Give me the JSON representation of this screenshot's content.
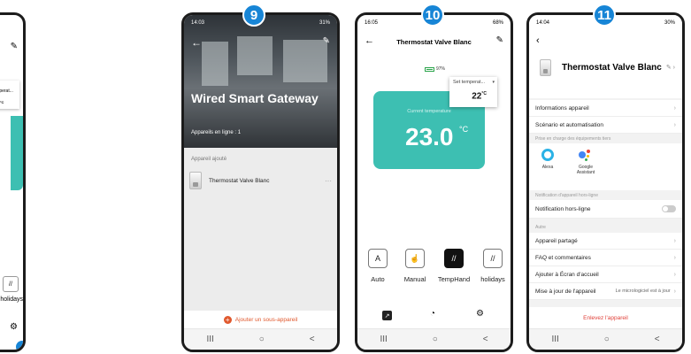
{
  "partial_phone": {
    "set_label": "Set temperat...",
    "set_value": "22",
    "set_unit": "°C",
    "holidays": "holidays",
    "edit_icon": "pencil-icon",
    "gear_icon": "gear-icon"
  },
  "phone9": {
    "badge": "9",
    "status": {
      "time": "14:03",
      "right": "31%"
    },
    "title": "Wired Smart Gateway",
    "online": "Appareils en ligne : 1",
    "section": "Appareil ajouté",
    "device": "Thermostat Valve Blanc",
    "more": "···",
    "add": "Ajouter un sous-appareil"
  },
  "phone10": {
    "badge": "10",
    "status": {
      "time": "16:05",
      "right": "68%"
    },
    "title": "Thermostat Valve Blanc",
    "battery": "97%",
    "current_label": "Current temperature",
    "current_value": "23.0",
    "current_unit": "°C",
    "set_label": "Set temperat...",
    "set_value": "22",
    "set_unit": "°C",
    "modes": [
      {
        "label": "Auto",
        "glyph": "A"
      },
      {
        "label": "Manual",
        "glyph": "☝"
      },
      {
        "label": "TempHand",
        "glyph": "//"
      },
      {
        "label": "holidays",
        "glyph": "//"
      }
    ]
  },
  "phone11": {
    "badge": "11",
    "status": {
      "time": "14:04",
      "right": "30%"
    },
    "device": "Thermostat Valve Blanc",
    "rows_top": [
      "Informations appareil",
      "Scénario et automatisation"
    ],
    "section_assist": "Prise en charge des équipements tiers",
    "alexa": "Alexa",
    "google": "Google Assistant",
    "section_offline": "Notification d'appareil hors-ligne",
    "offline_row": "Notification hors-ligne",
    "section_other": "Autre",
    "rows_other": [
      "Appareil partagé",
      "FAQ et commentaires",
      "Ajouter à Écran d'accueil"
    ],
    "update_label": "Mise à jour de l'appareil",
    "update_value": "Le micrologiciel est à jour",
    "remove": "Enlevez l'appareil"
  },
  "navbar": {
    "recents": "III",
    "home": "○",
    "back": "<"
  }
}
